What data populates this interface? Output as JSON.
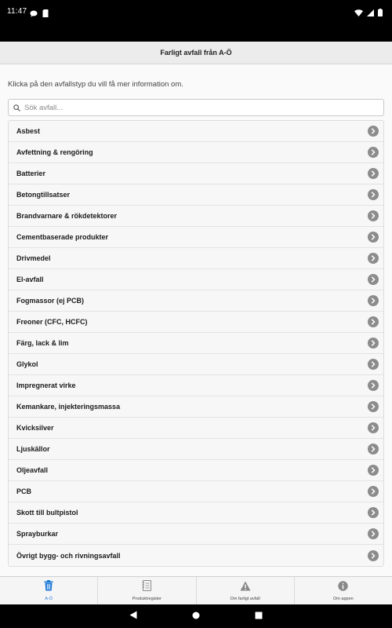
{
  "status_bar": {
    "time": "11:47",
    "left_icons": [
      "chat-icon",
      "sd-card-icon"
    ],
    "right_icons": [
      "wifi-icon",
      "signal-icon",
      "battery-icon"
    ]
  },
  "header": {
    "title": "Farligt avfall från A-Ö"
  },
  "intro_text": "Klicka på den avfallstyp du vill få mer information om.",
  "search": {
    "placeholder": "Sök avfall...",
    "value": ""
  },
  "items": [
    {
      "label": "Asbest"
    },
    {
      "label": "Avfettning & rengöring"
    },
    {
      "label": "Batterier"
    },
    {
      "label": "Betongtillsatser"
    },
    {
      "label": "Brandvarnare & rökdetektorer"
    },
    {
      "label": "Cementbaserade produkter"
    },
    {
      "label": "Drivmedel"
    },
    {
      "label": "El-avfall"
    },
    {
      "label": "Fogmassor (ej PCB)"
    },
    {
      "label": "Freoner (CFC, HCFC)"
    },
    {
      "label": "Färg, lack & lim"
    },
    {
      "label": "Glykol"
    },
    {
      "label": "Impregnerat virke"
    },
    {
      "label": "Kemankare, injekteringsmassa"
    },
    {
      "label": "Kvicksilver"
    },
    {
      "label": "Ljuskällor"
    },
    {
      "label": "Oljeavfall"
    },
    {
      "label": "PCB"
    },
    {
      "label": "Skott till bultpistol"
    },
    {
      "label": "Sprayburkar"
    },
    {
      "label": "Övrigt bygg- och rivningsavfall"
    }
  ],
  "tabs": [
    {
      "label": "A-Ö",
      "icon": "trash-icon",
      "active": true
    },
    {
      "label": "Produktregister",
      "icon": "notebook-icon",
      "active": false
    },
    {
      "label": "Om farligt avfall",
      "icon": "warning-icon",
      "active": false
    },
    {
      "label": "Om appen",
      "icon": "info-icon",
      "active": false
    }
  ],
  "colors": {
    "accent": "#1f7ad8",
    "chevron": "#8c8c8c",
    "header_bg": "#ececec"
  }
}
